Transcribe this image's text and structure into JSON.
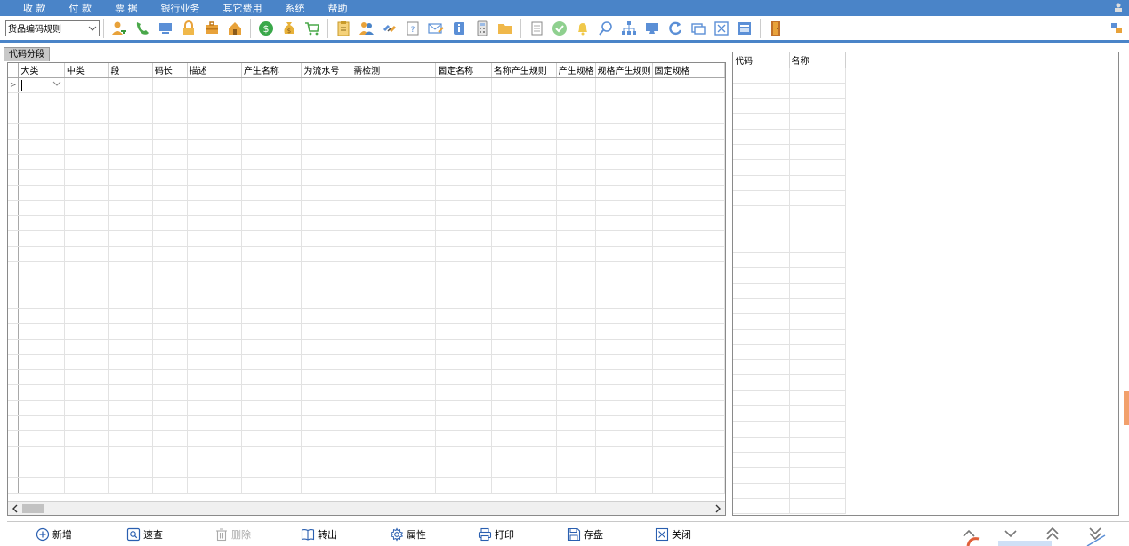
{
  "menu": {
    "items": [
      "收 款",
      "付 款",
      "票 据",
      "银行业务",
      "其它费用",
      "系统",
      "帮助"
    ]
  },
  "toolbar": {
    "combo_value": "货品编码规则",
    "buttons": [
      "user-key-icon",
      "phone-icon",
      "monitor-icon",
      "lock-icon",
      "briefcase-icon",
      "home-icon",
      "dollar-coin-icon",
      "money-bag-icon",
      "cart-icon",
      "clipboard-icon",
      "users-icon",
      "link-icon",
      "help-doc-icon",
      "mail-edit-icon",
      "info-icon",
      "calculator-icon",
      "folder-icon",
      "document-icon",
      "check-circle-icon",
      "bell-icon",
      "search-icon",
      "org-chart-icon",
      "display-icon",
      "refresh-icon",
      "window-icon",
      "close-box-icon",
      "form-icon",
      "exit-door-icon"
    ],
    "accent_color": "#4a84c8"
  },
  "tab": {
    "label": "代码分段"
  },
  "main_grid": {
    "columns": [
      {
        "label": "大类"
      },
      {
        "label": "中类"
      },
      {
        "label": "段"
      },
      {
        "label": "码长"
      },
      {
        "label": "描述"
      },
      {
        "label": "产生名称"
      },
      {
        "label": "为流水号"
      },
      {
        "label": "需检测"
      },
      {
        "label": "固定名称"
      },
      {
        "label": "名称产生规则"
      },
      {
        "label": "产生规格"
      },
      {
        "label": "规格产生规则"
      },
      {
        "label": "固定规格"
      }
    ],
    "row_count": 27,
    "current_row_marker": ">"
  },
  "side_grid": {
    "columns": [
      "代码",
      "名称"
    ],
    "row_count": 29
  },
  "actions": [
    {
      "label": "新增",
      "icon": "plus-circle-icon",
      "enabled": true
    },
    {
      "label": "速查",
      "icon": "search-box-icon",
      "enabled": true
    },
    {
      "label": "删除",
      "icon": "trash-icon",
      "enabled": false
    },
    {
      "label": "转出",
      "icon": "book-icon",
      "enabled": true
    },
    {
      "label": "属性",
      "icon": "gear-icon",
      "enabled": true
    },
    {
      "label": "打印",
      "icon": "printer-icon",
      "enabled": true
    },
    {
      "label": "存盘",
      "icon": "save-icon",
      "enabled": true
    },
    {
      "label": "关闭",
      "icon": "close-box-icon",
      "enabled": true
    }
  ]
}
